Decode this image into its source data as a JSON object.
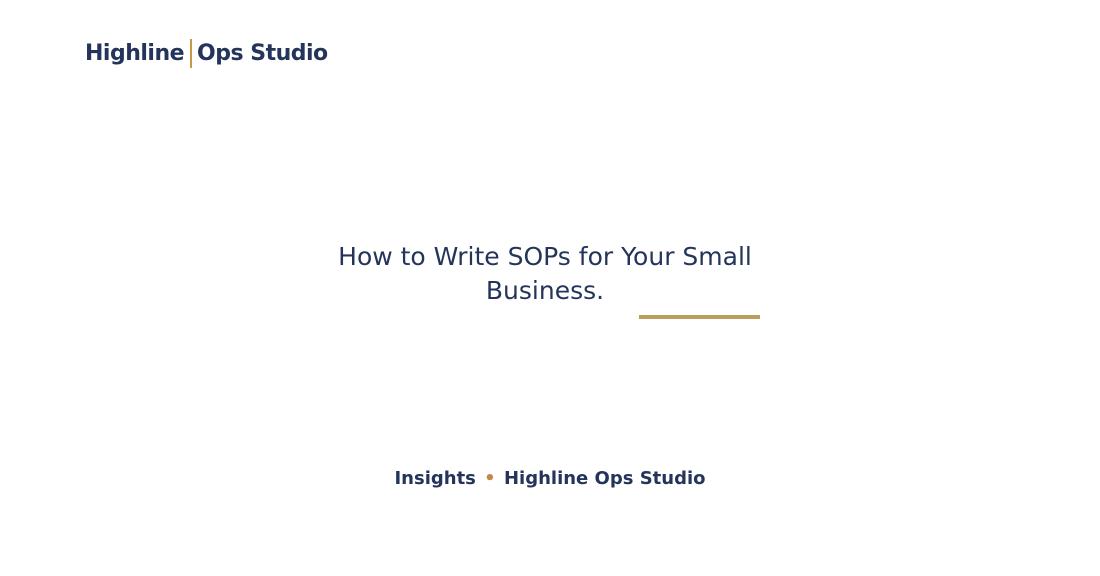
{
  "brand": {
    "name_left": "Highline",
    "name_right": "Ops Studio",
    "accent_color": "#c49a4a",
    "text_color": "#24345a"
  },
  "hero": {
    "title": "How to Write SOPs for Your Small Business."
  },
  "footer": {
    "category": "Insights",
    "separator": "•",
    "author": "Highline Ops Studio"
  }
}
